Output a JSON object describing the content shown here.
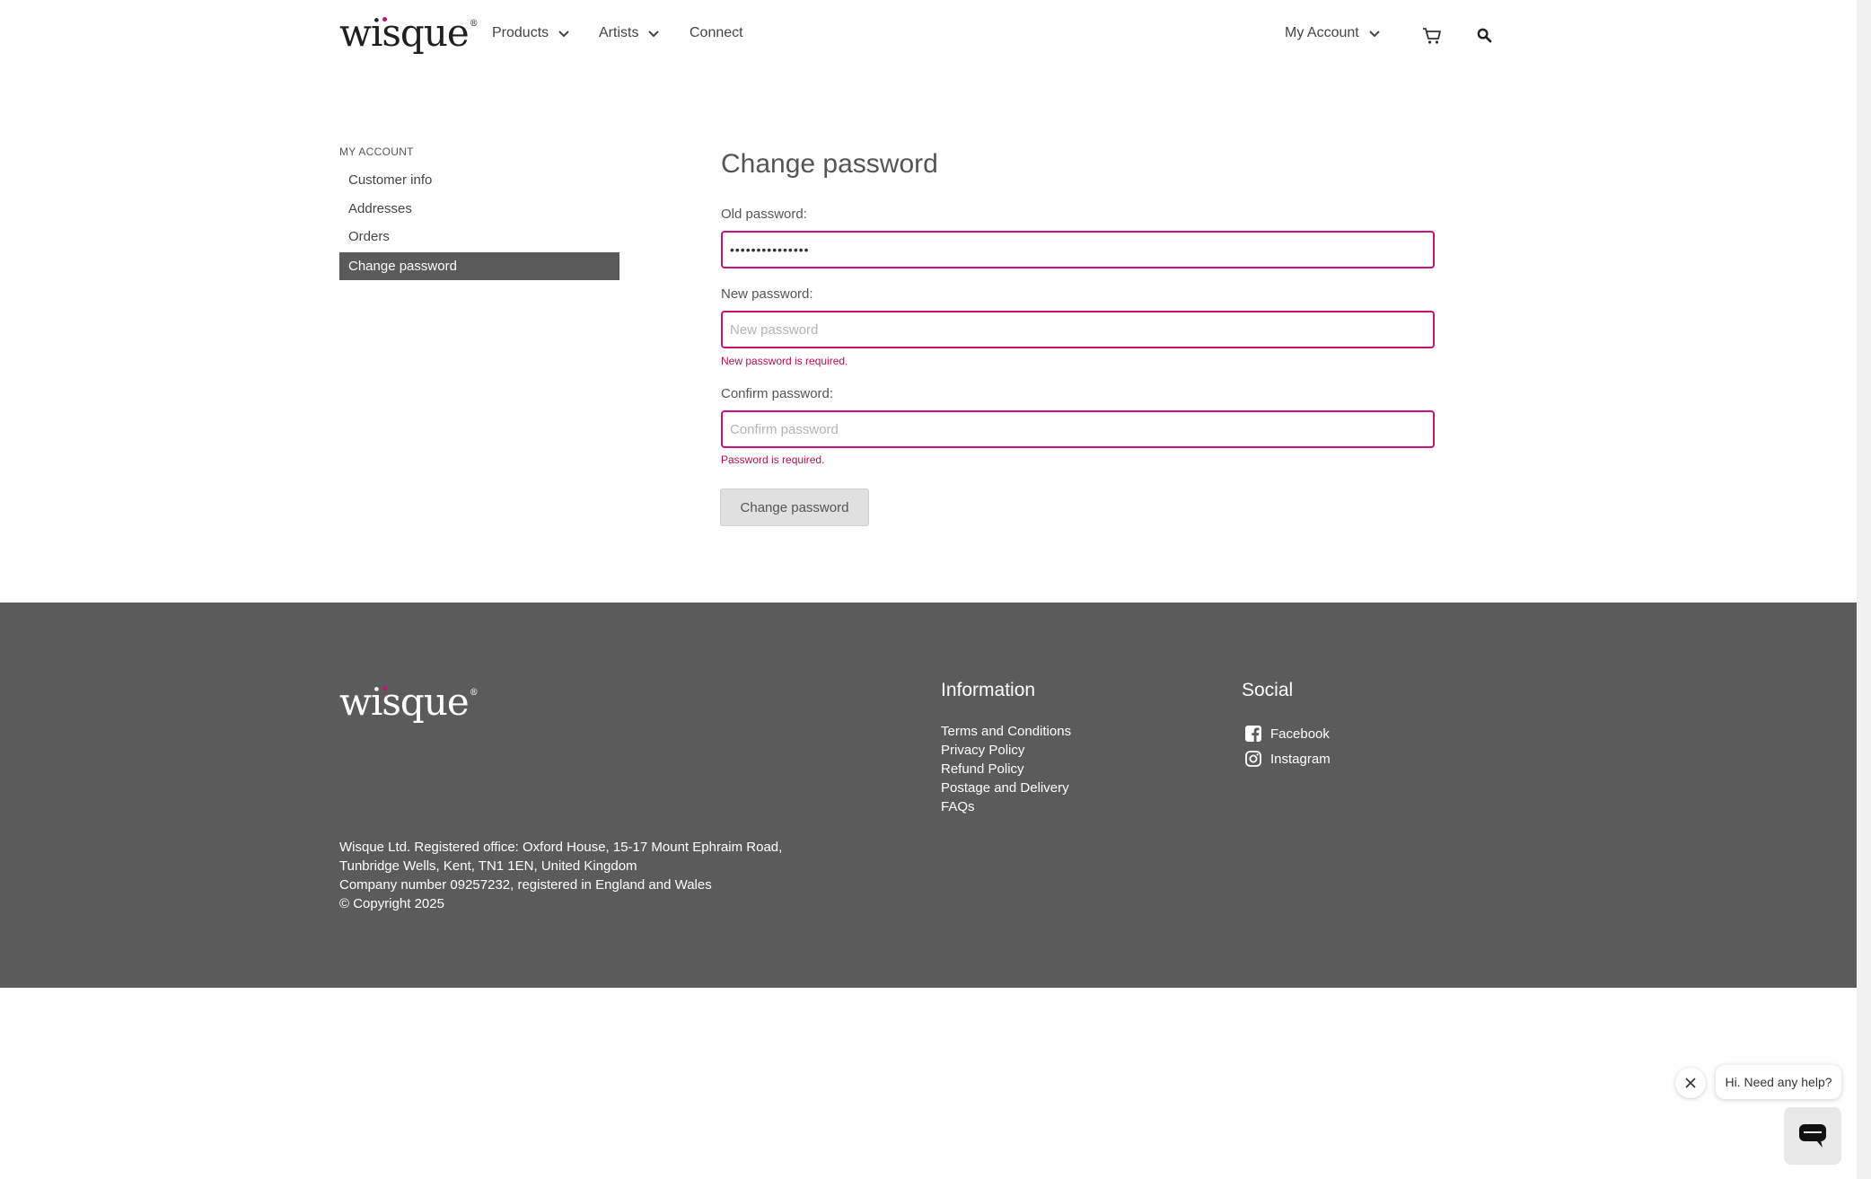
{
  "brand": {
    "name": "wisque",
    "reg_mark": "®"
  },
  "nav": {
    "products": "Products",
    "artists": "Artists",
    "connect": "Connect",
    "my_account": "My Account",
    "cart_icon": "cart-icon",
    "search_icon": "search-icon"
  },
  "sidebar": {
    "title": "MY ACCOUNT",
    "items": [
      {
        "label": "Customer info"
      },
      {
        "label": "Addresses"
      },
      {
        "label": "Orders"
      },
      {
        "label": "Change password",
        "active": true
      }
    ]
  },
  "form": {
    "title": "Change password",
    "old_label": "Old password:",
    "old_value": "•••••••••••••••",
    "new_label": "New password:",
    "new_placeholder": "New password",
    "new_error": "New password is required.",
    "confirm_label": "Confirm password:",
    "confirm_placeholder": "Confirm password",
    "confirm_error": "Password is required.",
    "submit": "Change password"
  },
  "footer": {
    "info_heading": "Information",
    "info_links": [
      "Terms and Conditions",
      "Privacy Policy",
      "Refund Policy",
      "Postage and Delivery",
      "FAQs"
    ],
    "social_heading": "Social",
    "social_links": [
      "Facebook",
      "Instagram"
    ],
    "address_lines": [
      "Wisque Ltd. Registered office: Oxford House, 15-17 Mount Ephraim Road,",
      "Tunbridge Wells, Kent, TN1 1EN, United Kingdom",
      "Company number 09257232, registered in England and Wales",
      "© Copyright 2025"
    ]
  },
  "chat": {
    "greeting": "Hi. Need any help?"
  },
  "colors": {
    "accent": "#c4127a",
    "error": "#b0124f",
    "footer_bg": "#5b5b5b",
    "active_bg": "#5a5a5a"
  }
}
